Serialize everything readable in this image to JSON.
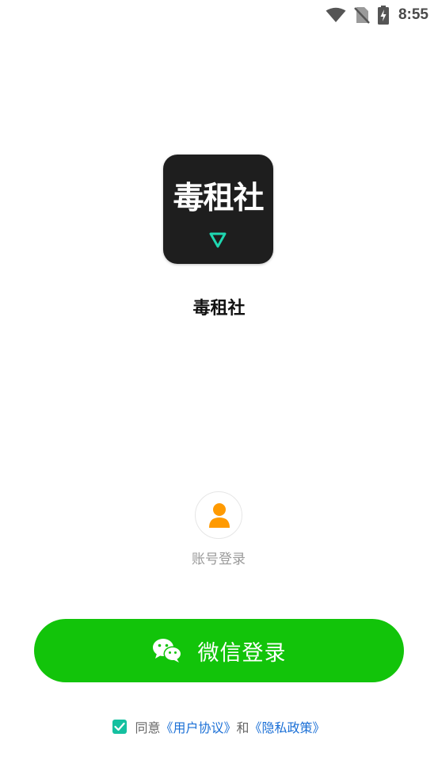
{
  "status_bar": {
    "time": "8:55",
    "icons": [
      "wifi-icon",
      "no-sim-icon",
      "battery-charging-icon"
    ]
  },
  "app": {
    "logo_text": "毒租社",
    "logo_icon": "down-triangle-icon",
    "name": "毒租社"
  },
  "account_login": {
    "icon": "user-icon",
    "label": "账号登录"
  },
  "wechat_login": {
    "icon": "wechat-icon",
    "label": "微信登录"
  },
  "agreement": {
    "checked": true,
    "prefix": "同意",
    "user_agreement": "《用户协议》",
    "conjunction": "和",
    "privacy_policy": "《隐私政策》"
  },
  "colors": {
    "wechat_green": "#12c40a",
    "link_blue": "#1a6fd6",
    "checkbox_teal": "#14c0a0",
    "avatar_orange": "#ff9a00",
    "logo_accent": "#1fd6b0"
  }
}
